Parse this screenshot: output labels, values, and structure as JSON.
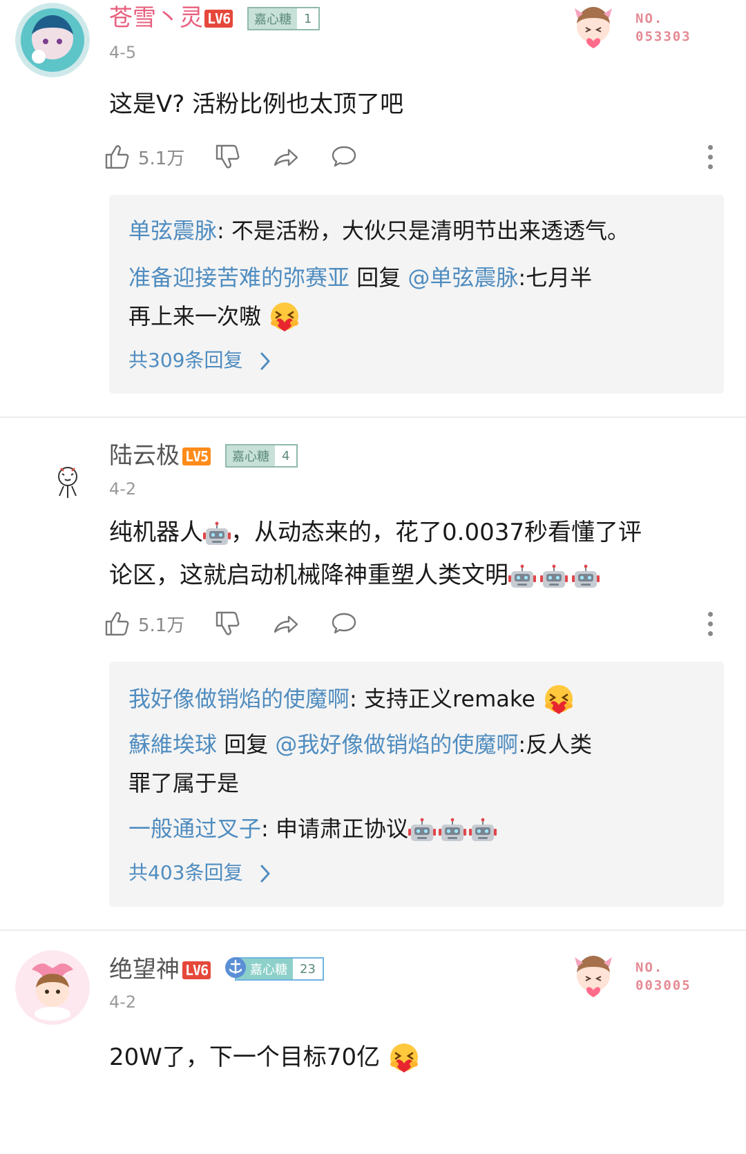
{
  "comments": [
    {
      "username": "苍雪丶灵",
      "level": "LV6",
      "medal_name": "嘉心糖",
      "medal_level": "1",
      "fan_no_label": "NO.",
      "fan_no_value": "053303",
      "date": "4-5",
      "text": "这是V? 活粉比例也太顶了吧",
      "likes": "5.1万",
      "replies": [
        {
          "user": "单弦震脉",
          "text": ": 不是活粉，大伙只是清明节出来透透气。"
        },
        {
          "user": "准备迎接苦难的弥赛亚",
          "reply_word": "回复",
          "mention": "@单弦震脉",
          "text1": ":七月半",
          "text2": "再上来一次嗷"
        }
      ],
      "more_replies": "共309条回复"
    },
    {
      "username": "陆云极",
      "level": "LV5",
      "medal_name": "嘉心糖",
      "medal_level": "4",
      "date": "4-2",
      "text1": "纯机器人",
      "text2": "，从动态来的，花了0.0037秒看懂了评",
      "text3": "论区，这就启动机械降神重塑人类文明",
      "likes": "5.1万",
      "replies": [
        {
          "user": "我好像做销焰的使魔啊",
          "text": ": 支持正义remake"
        },
        {
          "user": "蘇維埃球",
          "reply_word": "回复",
          "mention": "@我好像做销焰的使魔啊",
          "text1": ":反人类",
          "text2": "罪了属于是"
        },
        {
          "user": "一般通过叉子",
          "text": ": 申请肃正协议"
        }
      ],
      "more_replies": "共403条回复"
    },
    {
      "username": "绝望神",
      "level": "LV6",
      "medal_name": "嘉心糖",
      "medal_level": "23",
      "fan_no_label": "NO.",
      "fan_no_value": "003005",
      "date": "4-2",
      "text": "20W了，下一个目标70亿"
    }
  ],
  "colors": {
    "username_vip": "#e8607e",
    "link_blue": "#4f8cbf",
    "level_lv6": "#e5483a",
    "level_lv5": "#ff8c1a",
    "medal_border": "#8fb9ac",
    "reply_bg": "#f4f4f4"
  },
  "icons": [
    "like-icon",
    "dislike-icon",
    "share-icon",
    "reply-icon",
    "more-icon",
    "chevron-right-icon",
    "heart-hug-emoji",
    "robot-emoji"
  ]
}
